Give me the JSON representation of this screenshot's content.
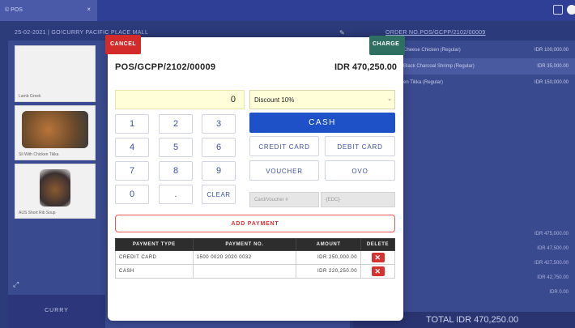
{
  "window": {
    "tab_label": "© POS",
    "close_glyph": "×"
  },
  "left_panel": {
    "header": "25-02-2021 | GO!CURRY PACIFIC PLACE MALL",
    "items": [
      {
        "label": "Lamb Greek"
      },
      {
        "label": "Sil With Chicken Tikka"
      },
      {
        "label": "AUS Short Rib Soup"
      }
    ],
    "category_tab": "CURRY"
  },
  "order_panel": {
    "header": "ORDER NO.POS/GCPP/2102/00009",
    "items": [
      {
        "name": "Cheese Chicken (Regular)",
        "price": "IDR 100,000.00"
      },
      {
        "name": "Black Charcoal Shrimp (Regular)",
        "price": "IDR 35,000.00"
      },
      {
        "name": "en Tikka (Regular)",
        "price": "IDR 150,000.00"
      }
    ],
    "summary": [
      "IDR 475,000.00",
      "IDR 47,500.00",
      "IDR 427,500.00",
      "IDR 42,750.00",
      "IDR 0.00"
    ],
    "total": "TOTAL IDR 470,250.00"
  },
  "modal": {
    "cancel_label": "CANCEL",
    "charge_label": "CHARGE",
    "order_no": "POS/GCPP/2102/00009",
    "order_total": "IDR 470,250.00",
    "amount_value": "0",
    "discount": {
      "selected": "Discount 10%"
    },
    "keypad": [
      "1",
      "2",
      "3",
      "4",
      "5",
      "6",
      "7",
      "8",
      "9",
      "0",
      ".",
      "CLEAR"
    ],
    "methods": {
      "cash": "CASH",
      "credit_card": "CREDIT CARD",
      "debit_card": "DEBIT CARD",
      "voucher": "VOUCHER",
      "ovo": "OVO"
    },
    "card_input_placeholder": "Card/Voucher #",
    "edc_placeholder": "-[EDC]-",
    "add_payment_label": "ADD PAYMENT",
    "table": {
      "headers": [
        "PAYMENT TYPE",
        "PAYMENT NO.",
        "AMOUNT",
        "DELETE"
      ],
      "rows": [
        {
          "type": "CREDIT CARD",
          "no": "1500 0020 2020 0032",
          "amount": "IDR 250,000.00"
        },
        {
          "type": "CASH",
          "no": "",
          "amount": "IDR 220,250.00"
        }
      ]
    }
  },
  "colors": {
    "background": "#2c3c7a",
    "cancel": "#d32a2a",
    "charge": "#2f6f61",
    "cash_button": "#1e50c8",
    "delete_button": "#d9312e",
    "amount_field": "#fffed9"
  }
}
